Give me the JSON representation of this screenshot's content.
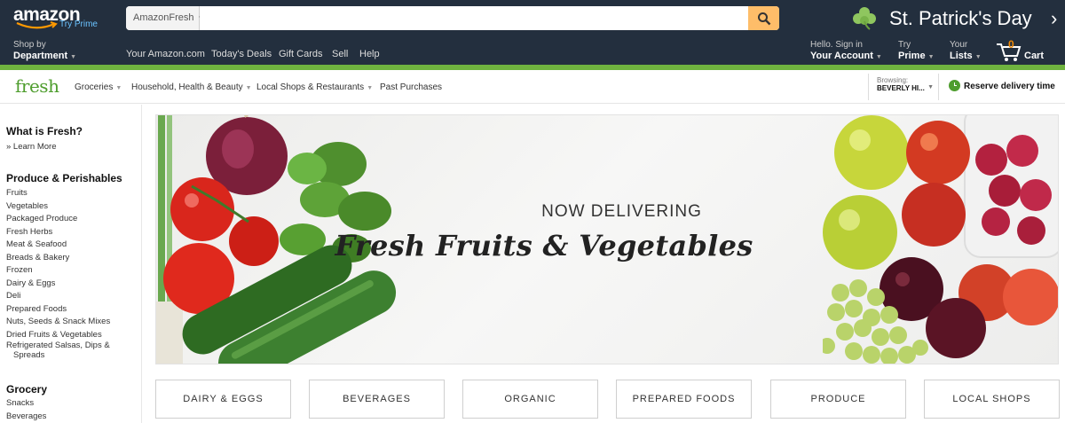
{
  "header": {
    "logo_text": "amazon",
    "logo_sub": "Try Prime",
    "search_scope": "AmazonFresh",
    "search_value": "",
    "promo_text": "St. Patrick's Day"
  },
  "belt": {
    "dept_small": "Shop by",
    "dept_big": "Department",
    "links": [
      "Your Amazon.com",
      "Today's Deals",
      "Gift Cards",
      "Sell",
      "Help"
    ],
    "account_small": "Hello. Sign in",
    "account_big": "Your Account",
    "prime_small": "Try",
    "prime_big": "Prime",
    "lists_small": "Your",
    "lists_big": "Lists",
    "cart_count": "0",
    "cart_label": "Cart"
  },
  "subnav": {
    "logo": "fresh",
    "links": [
      "Groceries",
      "Household, Health & Beauty",
      "Local Shops & Restaurants",
      "Past Purchases"
    ],
    "browsing_label": "Browsing:",
    "browsing_value": "BEVERLY HI...",
    "reserve": "Reserve delivery time"
  },
  "sidebar": {
    "what_heading": "What is Fresh?",
    "learn_more": "» Learn More",
    "produce_heading": "Produce & Perishables",
    "produce_items": [
      "Fruits",
      "Vegetables",
      "Packaged Produce",
      "Fresh Herbs",
      "Meat & Seafood",
      "Breads & Bakery",
      "Frozen",
      "Dairy & Eggs",
      "Deli",
      "Prepared Foods",
      "Nuts, Seeds & Snack Mixes",
      "Dried Fruits & Vegetables"
    ],
    "refrig_line1": "Refrigerated Salsas, Dips &",
    "refrig_line2": "Spreads",
    "grocery_heading": "Grocery",
    "grocery_items": [
      "Snacks",
      "Beverages"
    ]
  },
  "hero": {
    "kicker": "NOW DELIVERING",
    "title": "Fresh Fruits & Vegetables"
  },
  "tiles": [
    "DAIRY & EGGS",
    "BEVERAGES",
    "ORGANIC",
    "PREPARED FOODS",
    "PRODUCE",
    "LOCAL SHOPS"
  ],
  "colors": {
    "nav_bg": "#232f3e",
    "accent_green": "#6fb33f",
    "fresh_green": "#4e9d2d",
    "search_button": "#febd69",
    "cart_orange": "#f08804"
  }
}
